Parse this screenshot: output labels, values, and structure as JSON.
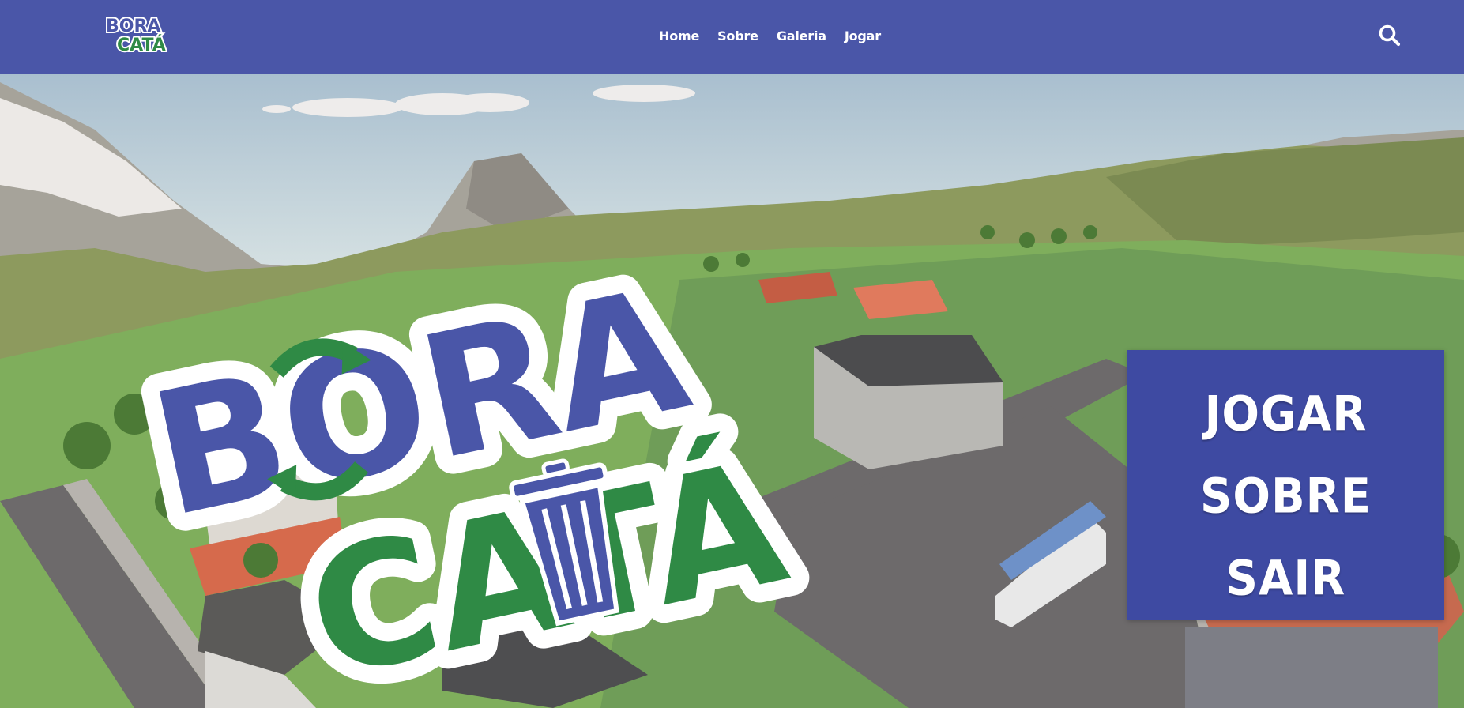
{
  "header": {
    "logo_text": [
      "BORA",
      "CATÁ"
    ],
    "nav": [
      {
        "label": "Home"
      },
      {
        "label": "Sobre"
      },
      {
        "label": "Galeria"
      },
      {
        "label": "Jogar"
      }
    ],
    "search_icon": "search-icon"
  },
  "hero": {
    "logo_text": [
      "BORA",
      "CATÁ"
    ],
    "menu": {
      "items": [
        {
          "label": "JOGAR"
        },
        {
          "label": "SOBRE"
        },
        {
          "label": "SAIR"
        }
      ]
    }
  },
  "colors": {
    "brand_blue": "#4a56a8",
    "panel_blue": "#3e4aa2",
    "logo_green": "#2f8a45",
    "white": "#ffffff"
  }
}
